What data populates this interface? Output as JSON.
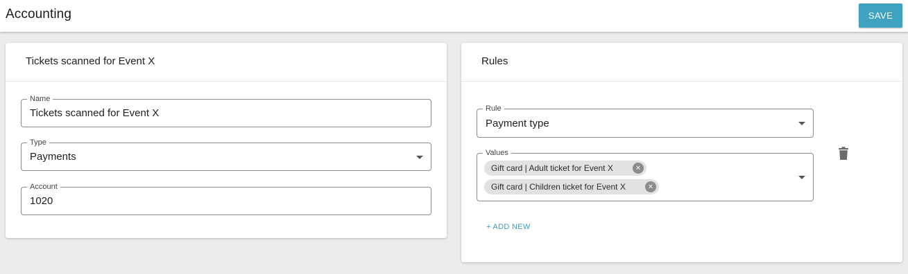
{
  "header": {
    "title": "Accounting",
    "save_label": "SAVE"
  },
  "left_card": {
    "title": "Tickets scanned for Event X",
    "name_field": {
      "label": "Name",
      "value": "Tickets scanned for Event X"
    },
    "type_field": {
      "label": "Type",
      "value": "Payments"
    },
    "account_field": {
      "label": "Account",
      "value": "1020"
    }
  },
  "right_card": {
    "title": "Rules",
    "rule_field": {
      "label": "Rule",
      "value": "Payment type"
    },
    "values_field": {
      "label": "Values",
      "chips": [
        "Gift card | Adult ticket for Event X",
        "Gift card | Children ticket for Event X"
      ]
    },
    "add_new_label": "+ ADD NEW",
    "delete_icon": "trash-icon"
  },
  "colors": {
    "accent": "#3fa2be",
    "background": "#ececec",
    "link": "#3a9cbc"
  }
}
